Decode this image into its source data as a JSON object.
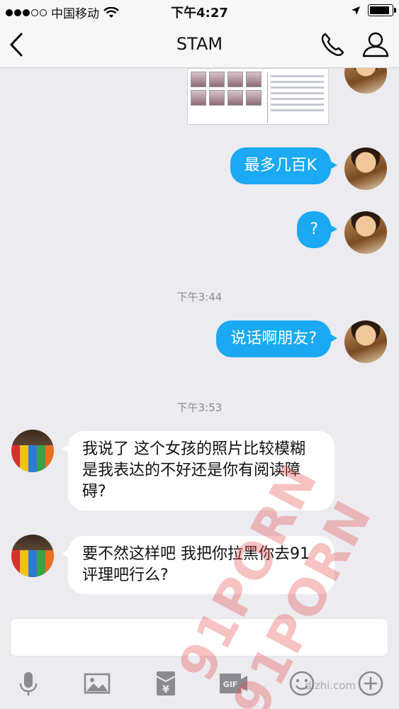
{
  "status_bar": {
    "carrier": "中国移动",
    "time": "下午4:27",
    "battery_level": 0.9
  },
  "nav": {
    "title": "STAM",
    "icons": [
      "back-chevron-icon",
      "phone-icon",
      "contact-icon"
    ]
  },
  "messages": [
    {
      "from": "me",
      "type": "image"
    },
    {
      "from": "me",
      "type": "text",
      "text": "最多几百K"
    },
    {
      "from": "me",
      "type": "text",
      "text": "?"
    },
    {
      "type": "timestamp",
      "text": "下午3:44"
    },
    {
      "from": "me",
      "type": "text",
      "text": "说话啊朋友?"
    },
    {
      "type": "timestamp",
      "text": "下午3:53"
    },
    {
      "from": "other",
      "type": "text",
      "text": "我说了 这个女孩的照片比较模糊 是我表达的不好还是你有阅读障碍?"
    },
    {
      "from": "other",
      "type": "text",
      "text": "要不然这样吧 我把你拉黑你去91评理吧行么?"
    }
  ],
  "toolbar": {
    "icons": [
      "microphone-icon",
      "image-icon",
      "red-packet-icon",
      "gif-icon",
      "emoji-icon",
      "plus-icon"
    ],
    "gif_label": "GIF",
    "red_packet_symbol": "¥"
  },
  "watermarks": {
    "text_1": "91PORN",
    "text_2": "91PORN",
    "site": "dizhi.com"
  },
  "colors": {
    "my_bubble": "#1aa9f2",
    "other_bubble": "#ffffff",
    "background": "#ebebf0"
  }
}
